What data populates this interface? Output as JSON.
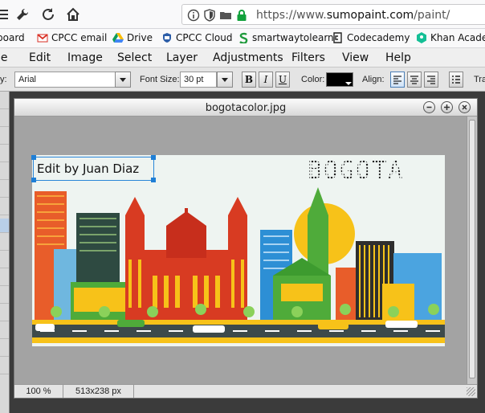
{
  "browser": {
    "url_prefix": "https://www.",
    "url_host": "sumopaint.com",
    "url_path": "/paint/"
  },
  "bookmarks": [
    {
      "label": "board",
      "icon": "bookmark-icon"
    },
    {
      "label": "CPCC email",
      "icon": "gmail-icon"
    },
    {
      "label": "Drive",
      "icon": "drive-icon"
    },
    {
      "label": "CPCC Cloud",
      "icon": "cloud-icon"
    },
    {
      "label": "smartwaytolearn",
      "icon": "s-logo-icon"
    },
    {
      "label": "Codecademy",
      "icon": "codecademy-icon"
    },
    {
      "label": "Khan Acader",
      "icon": "khan-icon"
    }
  ],
  "menu": [
    "le",
    "Edit",
    "Image",
    "Select",
    "Layer",
    "Adjustments",
    "Filters",
    "View",
    "Help"
  ],
  "text_options": {
    "font_label": "y:",
    "font_value": "Arial",
    "size_label": "Font Size:",
    "size_value": "30 pt",
    "bold": "B",
    "italic": "I",
    "underline": "U",
    "color_label": "Color:",
    "color_value": "#000000",
    "align_label": "Align:",
    "extra_label": "Tra"
  },
  "document": {
    "title": "bogotacolor.jpg",
    "zoom": "100 %",
    "dimensions": "513x238 px",
    "text_layer": "Edit by Juan Diaz",
    "image_title": "BOGOTA"
  },
  "colors": {
    "sky": "#eef4f1",
    "ground": "#3d4a4b",
    "red": "#d83b22",
    "yellow": "#f7c219",
    "green": "#4fab3a",
    "sun": "#f7c219"
  }
}
